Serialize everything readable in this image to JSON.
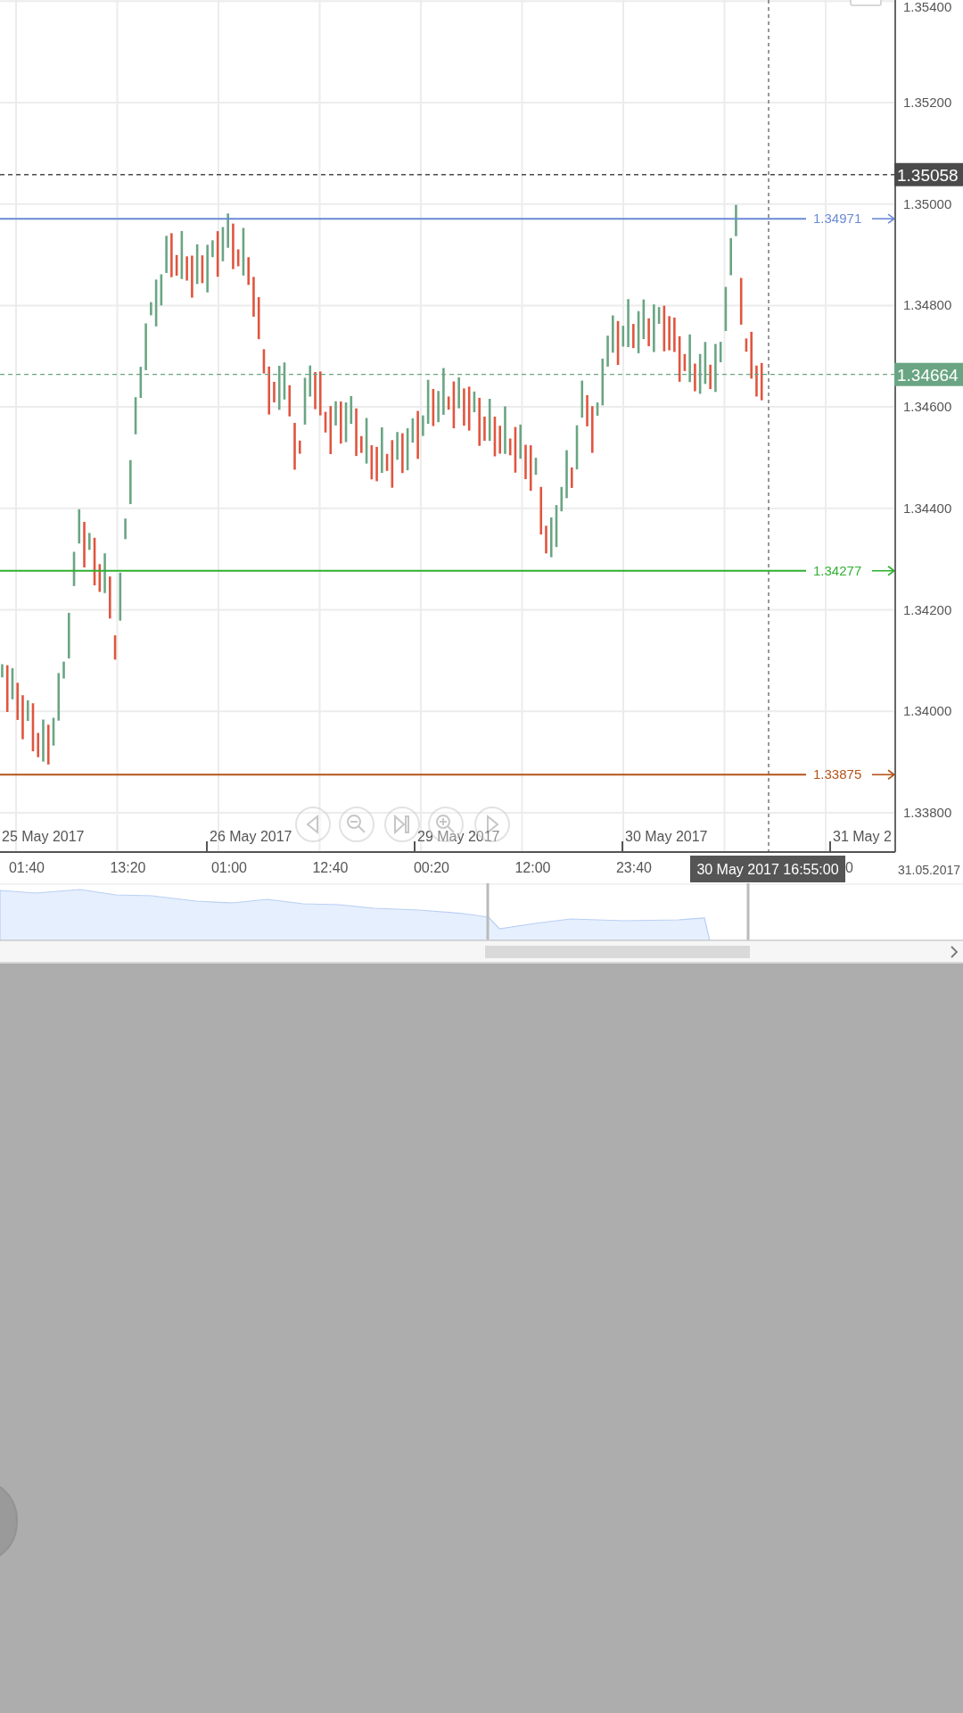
{
  "price_axis": {
    "ticks": [
      "1.35400",
      "1.35200",
      "1.35000",
      "1.34800",
      "1.34600",
      "1.34400",
      "1.34200",
      "1.34000",
      "1.33800"
    ]
  },
  "price_lines": [
    {
      "label": "1.34971",
      "color": "#6a8ad6"
    },
    {
      "label": "1.34277",
      "color": "#2fb12f"
    },
    {
      "label": "1.33875",
      "color": "#b5531a"
    }
  ],
  "price_markers": [
    {
      "label": "1.35058",
      "color": "#4a4a4a"
    },
    {
      "label": "1.34664",
      "color": "#6aa583"
    }
  ],
  "date_labels": [
    "25 May 2017",
    "26 May 2017",
    "29 May 2017",
    "30 May 2017",
    "31 May 2"
  ],
  "time_labels": [
    "01:40",
    "13:20",
    "01:00",
    "12:40",
    "00:20",
    "12:00",
    "23:40",
    "0"
  ],
  "crosshair_tooltip": "30 May 2017 16:55:00",
  "navigator": {
    "end_date": "31.05.2017"
  }
}
